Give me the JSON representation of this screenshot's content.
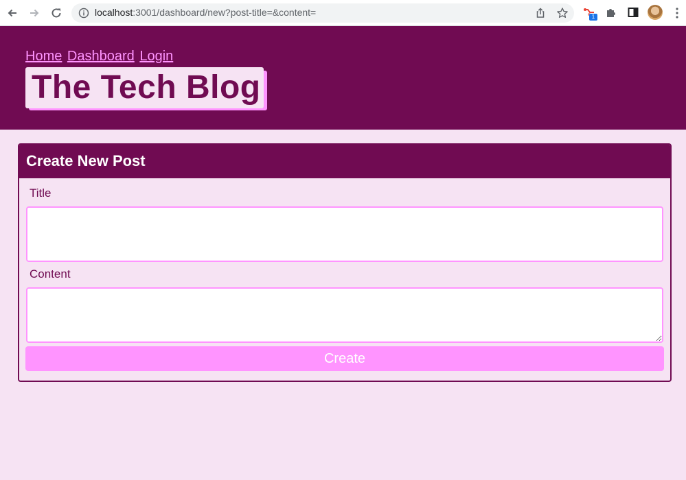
{
  "browser": {
    "url_host": "localhost",
    "url_rest": ":3001/dashboard/new?post-title=&content=",
    "extension_badge": "1"
  },
  "site": {
    "nav": [
      "Home",
      "Dashboard",
      "Login"
    ],
    "title": "The Tech Blog"
  },
  "form": {
    "heading": "Create New Post",
    "title_label": "Title",
    "title_value": "",
    "content_label": "Content",
    "content_value": "",
    "submit_label": "Create"
  },
  "colors": {
    "primary": "#700b52",
    "accent": "#ff94ff",
    "background": "#f6e3f3"
  },
  "icons": [
    "back-icon",
    "forward-icon",
    "reload-icon",
    "info-icon",
    "share-icon",
    "star-icon",
    "extension-icon",
    "puzzle-icon",
    "side-panel-icon",
    "menu-icon"
  ]
}
